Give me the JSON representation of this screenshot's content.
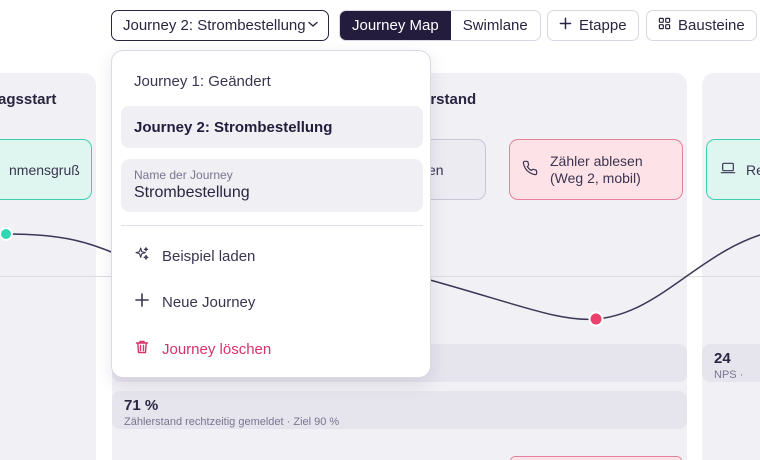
{
  "toolbar": {
    "journey_select": "Journey 2: Strombestellung",
    "view_journey_map": "Journey Map",
    "view_swimlane": "Swimlane",
    "add_stage": "Etappe",
    "blocks": "Bausteine"
  },
  "canvas": {
    "stages": [
      {
        "title": "agsstart"
      },
      {
        "title": "erstand"
      }
    ],
    "cards": [
      {
        "label": "nmensgruß"
      },
      {
        "label": "en"
      },
      {
        "label": "Zähler ablesen",
        "sub": "(Weg 2, mobil)"
      },
      {
        "label": "Re"
      }
    ],
    "metrics": [
      {
        "value": "71 %",
        "caption": "Zählerstand rechtzeitig gemeldet · Ziel 90 %"
      },
      {
        "value": "24",
        "caption": "NPS ·"
      }
    ]
  },
  "dropdown": {
    "journeys": [
      {
        "label": "Journey 1: Geändert",
        "selected": false
      },
      {
        "label": "Journey 2: Strombestellung",
        "selected": true
      }
    ],
    "name_field": {
      "label": "Name der Journey",
      "value": "Strombestellung"
    },
    "actions": {
      "load_example": "Beispiel laden",
      "new_journey": "Neue Journey",
      "delete_journey": "Journey löschen"
    }
  },
  "colors": {
    "accent_dark": "#241c3d",
    "positive": "#3fcfae",
    "negative": "#e9809b",
    "danger": "#d6336c"
  }
}
